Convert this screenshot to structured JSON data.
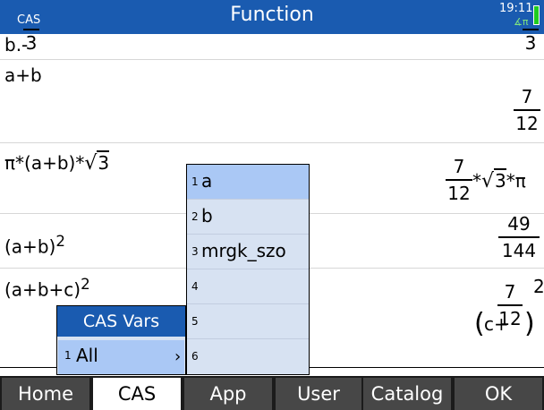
{
  "title_bar": {
    "mode": "CAS",
    "app": "Function",
    "time": "19:11",
    "angle": "∡π"
  },
  "history": {
    "r0": {
      "left": "b.-",
      "left_den": "3",
      "right_den": "3"
    },
    "r1": {
      "left": "a+b",
      "right_num": "7",
      "right_den": "12"
    },
    "r2": {
      "left_a": "π*(a+b)*",
      "left_sqrt": "3",
      "right_num": "7",
      "right_den": "12",
      "right_mid": "*",
      "right_sqrt": "3",
      "right_end": "*π"
    },
    "r3": {
      "left": "(a+b)",
      "left_exp": "2",
      "right_num": "49",
      "right_den": "144"
    },
    "r4": {
      "left": "(a+b+c)",
      "left_exp": "2",
      "right_a": "c+",
      "right_num": "7",
      "right_den": "12",
      "right_exp": "2"
    }
  },
  "cas_vars_menu": {
    "title": "CAS Vars",
    "items": [
      {
        "num": "1",
        "label": "All",
        "chevron": "›"
      }
    ]
  },
  "vars_submenu": {
    "items": [
      {
        "num": "1",
        "label": "a"
      },
      {
        "num": "2",
        "label": "b"
      },
      {
        "num": "3",
        "label": "mrgk_szo"
      },
      {
        "num": "4",
        "label": ""
      },
      {
        "num": "5",
        "label": ""
      },
      {
        "num": "6",
        "label": ""
      }
    ]
  },
  "menu_bar": [
    "Home",
    "CAS",
    "App",
    "User",
    "Catalog",
    "OK"
  ],
  "colors": {
    "title_bar": "#1a5bb0",
    "selection": "#aac8f5",
    "menu_background": "#d7e2f2",
    "soft_key": "#474747",
    "battery": "#1fcc1f"
  }
}
